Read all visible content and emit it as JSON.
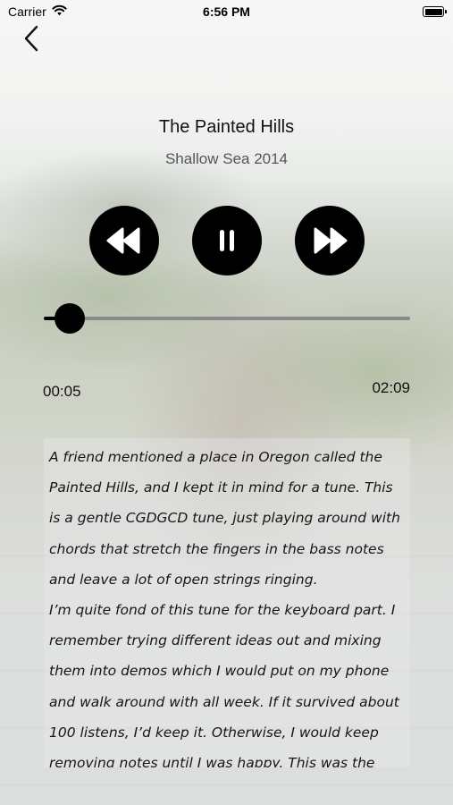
{
  "status_bar": {
    "carrier": "Carrier",
    "time": "6:56 PM",
    "battery_level": 1.0
  },
  "nav": {
    "back_icon": "chevron-left-icon"
  },
  "track": {
    "title": "The Painted Hills",
    "album": "Shallow Sea 2014"
  },
  "controls": {
    "rewind_icon": "rewind-icon",
    "pause_icon": "pause-icon",
    "forward_icon": "fast-forward-icon"
  },
  "progress": {
    "elapsed": "00:05",
    "total": "02:09",
    "fraction": 0.07
  },
  "description": {
    "paragraphs": [
      "A friend mentioned a place in Oregon called the Painted Hills, and I kept it in mind for a tune. This is a gentle CGDGCD tune, just playing around with chords that stretch the fingers in the bass notes and leave a lot of open strings ringing.",
      "I’m quite fond of this tune for the keyboard part. I remember trying different ideas out and mixing them into demos which I would put on my phone and walk around with all week. If it survived about 100 listens, I’d keep it. Otherwise, I would keep removing notes until I was happy. This was the"
    ]
  },
  "colors": {
    "accent": "#000000",
    "secondary_text": "#555555",
    "track_inactive": "#8a8a8a"
  }
}
